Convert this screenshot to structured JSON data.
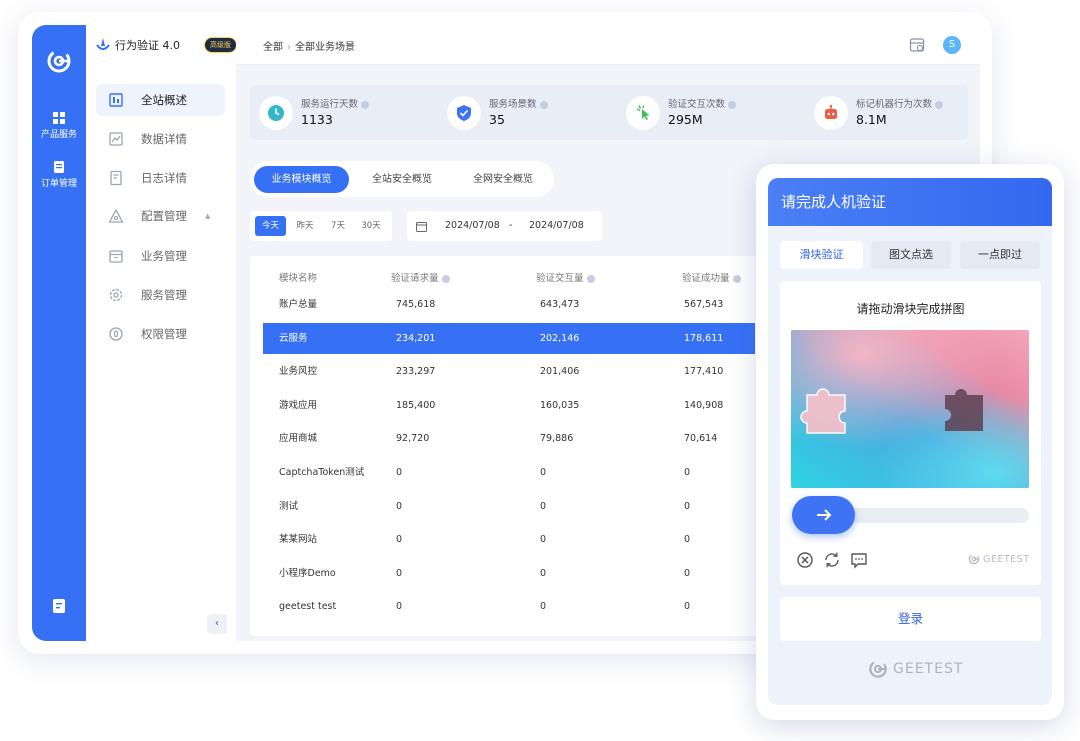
{
  "app": {
    "title": "行为验证 4.0",
    "edition": "高级版"
  },
  "rail": {
    "items": [
      {
        "label": "产品服务",
        "icon": "grid-icon"
      },
      {
        "label": "订单管理",
        "icon": "order-icon"
      }
    ]
  },
  "nav": {
    "items": [
      {
        "label": "全站概述",
        "icon": "overview-icon",
        "active": true
      },
      {
        "label": "数据详情",
        "icon": "data-chart-icon"
      },
      {
        "label": "日志详情",
        "icon": "log-icon"
      },
      {
        "label": "配置管理",
        "icon": "config-icon",
        "expandable": true
      },
      {
        "label": "业务管理",
        "icon": "business-icon"
      },
      {
        "label": "服务管理",
        "icon": "service-gear-icon"
      },
      {
        "label": "权限管理",
        "icon": "permission-icon"
      }
    ]
  },
  "breadcrumb": {
    "root": "全部",
    "current": "全部业务场景"
  },
  "user": {
    "avatar_letter": "S"
  },
  "stats": [
    {
      "label": "服务运行天数",
      "value": "1133",
      "icon": "clock-icon"
    },
    {
      "label": "服务场景数",
      "value": "35",
      "icon": "shield-check-icon"
    },
    {
      "label": "验证交互次数",
      "value": "295M",
      "icon": "click-icon"
    },
    {
      "label": "标记机器行为次数",
      "value": "8.1M",
      "icon": "robot-icon"
    }
  ],
  "view_tabs": [
    {
      "label": "业务模块概览",
      "active": true
    },
    {
      "label": "全站安全概览"
    },
    {
      "label": "全网安全概览"
    }
  ],
  "day_filter": [
    {
      "label": "今天",
      "active": true
    },
    {
      "label": "昨天"
    },
    {
      "label": "7天"
    },
    {
      "label": "30天"
    }
  ],
  "date_range": {
    "start": "2024/07/08",
    "separator": "-",
    "end": "2024/07/08"
  },
  "table": {
    "headers": [
      "模块名称",
      "验证请求量",
      "验证交互量",
      "验证成功量"
    ],
    "rows": [
      [
        "账户总量",
        "745,618",
        "643,473",
        "567,543"
      ],
      [
        "云服务",
        "234,201",
        "202,146",
        "178,611"
      ],
      [
        "业务风控",
        "233,297",
        "201,406",
        "177,410"
      ],
      [
        "游戏应用",
        "185,400",
        "160,035",
        "140,908"
      ],
      [
        "应用商城",
        "92,720",
        "79,886",
        "70,614"
      ],
      [
        "CaptchaToken测试",
        "0",
        "0",
        "0"
      ],
      [
        "测试",
        "0",
        "0",
        "0"
      ],
      [
        "某某网站",
        "0",
        "0",
        "0"
      ],
      [
        "小程序Demo",
        "0",
        "0",
        "0"
      ],
      [
        "geetest test",
        "0",
        "0",
        "0"
      ]
    ],
    "selected_row": 1
  },
  "captcha": {
    "title": "请完成人机验证",
    "tabs": [
      {
        "label": "滑块验证",
        "active": true
      },
      {
        "label": "图文点选"
      },
      {
        "label": "一点即过"
      }
    ],
    "prompt": "请拖动滑块完成拼图",
    "slider_progress": 0,
    "brand": "GEETEST",
    "login_label": "登录",
    "footer_brand": "GEETEST",
    "colors": {
      "accent": "#3671f5"
    }
  }
}
